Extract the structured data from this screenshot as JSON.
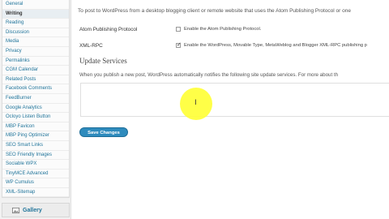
{
  "sidebar": {
    "items": [
      {
        "label": "General",
        "current": false
      },
      {
        "label": "Writing",
        "current": true
      },
      {
        "label": "Reading",
        "current": false
      },
      {
        "label": "Discussion",
        "current": false
      },
      {
        "label": "Media",
        "current": false
      },
      {
        "label": "Privacy",
        "current": false
      },
      {
        "label": "Permalinks",
        "current": false
      },
      {
        "label": "CGM Calendar",
        "current": false
      },
      {
        "label": "Related Posts",
        "current": false
      },
      {
        "label": "Facebook Comments",
        "current": false
      },
      {
        "label": "FeedBurner",
        "current": false
      },
      {
        "label": "Google Analytics",
        "current": false
      },
      {
        "label": "Ocloyo Listen Button",
        "current": false
      },
      {
        "label": "MBP Favicon",
        "current": false
      },
      {
        "label": "MBP Ping Optimizer",
        "current": false
      },
      {
        "label": "SEO Smart Links",
        "current": false
      },
      {
        "label": "SEO Friendly Images",
        "current": false
      },
      {
        "label": "Sociable WPX",
        "current": false
      },
      {
        "label": "TinyMCE Advanced",
        "current": false
      },
      {
        "label": "WP Cumulus",
        "current": false
      },
      {
        "label": "XML-Sitemap",
        "current": false
      }
    ],
    "gallery_label": "Gallery"
  },
  "main": {
    "intro": "To post to WordPress from a desktop blogging client or remote website that uses the Atom Publishing Protocol or one",
    "atom": {
      "label": "Atom Publishing Protocol",
      "checkbox_text": "Enable the Atom Publishing Protocol.",
      "checked": false
    },
    "xmlrpc": {
      "label": "XML-RPC",
      "checkbox_text": "Enable the WordPress, Movable Type, MetaWeblog and Blogger XML-RPC publishing p",
      "checked": true
    },
    "section_title": "Update Services",
    "description": "When you publish a new post, WordPress automatically notifies the following site update services. For more about th",
    "save_label": "Save Changes"
  },
  "colors": {
    "link": "#21759b",
    "button": "#2e8bbd",
    "highlight": "#ffff33"
  }
}
